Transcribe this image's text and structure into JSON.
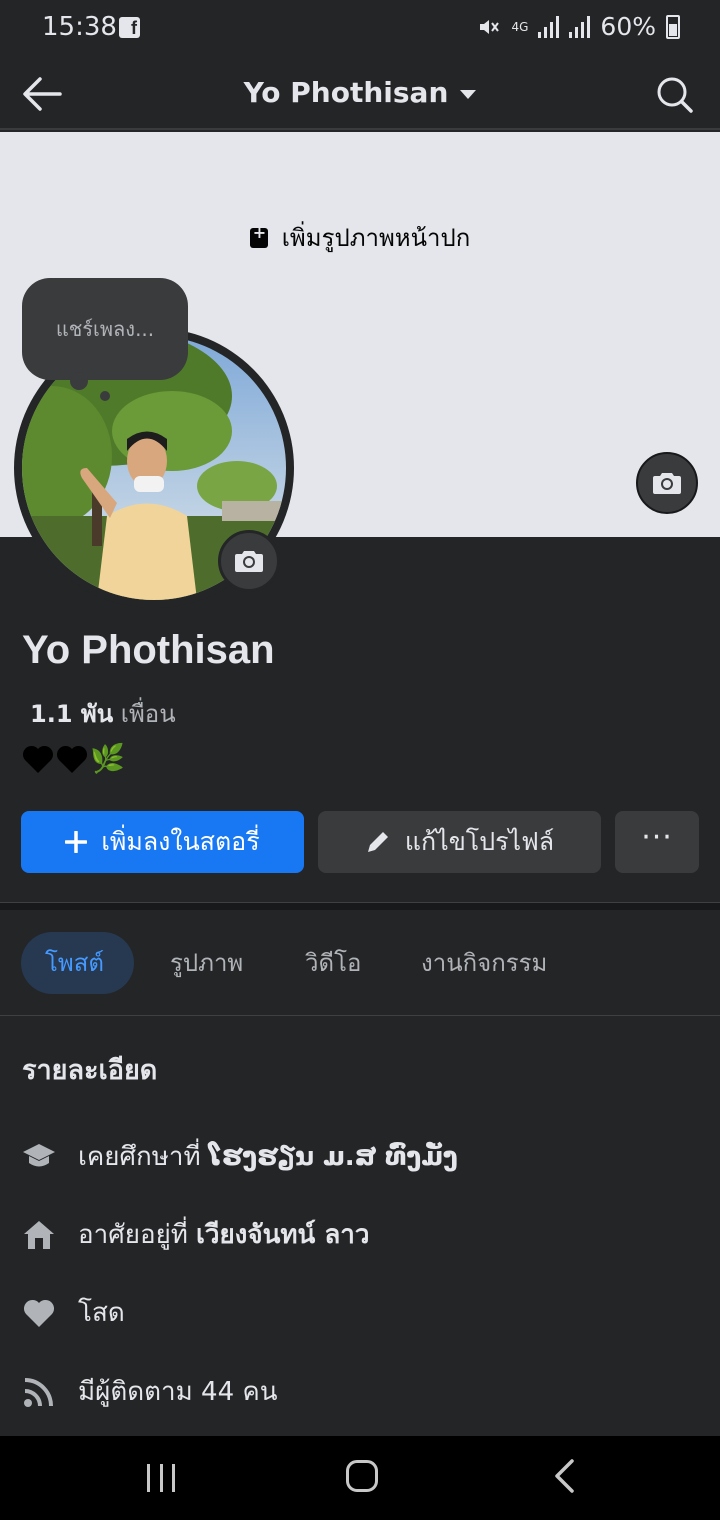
{
  "status": {
    "time": "15:38",
    "network": "4G",
    "battery": "60%"
  },
  "header": {
    "title": "Yo Phothisan"
  },
  "cover": {
    "add_cover_label": "เพิ่มรูปภาพหน้าปก"
  },
  "note": {
    "text": "แชร์เพลง..."
  },
  "profile": {
    "name": "Yo Phothisan",
    "friends_count": "1.1 พัน",
    "friends_label": "เพื่อน",
    "bio_emoji": "🌿"
  },
  "actions": {
    "add_story": "เพิ่มลงในสตอรี่",
    "edit_profile": "แก้ไขโปรไฟล์",
    "more": "···"
  },
  "tabs": [
    {
      "label": "โพสต์",
      "active": true
    },
    {
      "label": "รูปภาพ"
    },
    {
      "label": "วิดีโอ"
    },
    {
      "label": "งานกิจกรรม"
    }
  ],
  "details": {
    "title": "รายละเอียด",
    "education_prefix": "เคยศึกษาที่",
    "education_value": "ໂຮງຮຽນ ມ.ສ ທົ່ງມັ່ງ",
    "lives_prefix": "อาศัยอยู่ที่",
    "lives_value": "เวียงจันทน์ ลาว",
    "relationship": "โสด",
    "followers": "มีผู้ติดตาม 44 คน"
  },
  "colors": {
    "accent": "#1877f2",
    "background": "#242526",
    "tab_active": "#4599ff"
  }
}
